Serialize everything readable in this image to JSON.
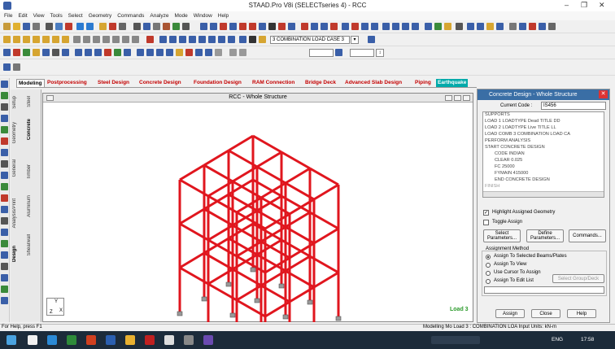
{
  "window": {
    "title": "STAAD.Pro V8i (SELECTseries 4) - RCC",
    "minimize": "–",
    "maximize": "❐",
    "close": "✕"
  },
  "menu": [
    "File",
    "Edit",
    "View",
    "Tools",
    "Select",
    "Geometry",
    "Commands",
    "Analyze",
    "Mode",
    "Window",
    "Help"
  ],
  "toolbar": {
    "load_case": "3 COMBINATION LOAD CASE 3"
  },
  "tabs": [
    "Modeling",
    "Postprocessing",
    "Steel Design",
    "Concrete Design",
    "Foundation Design",
    "RAM Connection",
    "Bridge Deck",
    "Advanced Slab Design",
    "Piping",
    "Earthquake"
  ],
  "vertical_tabs": [
    "Setup",
    "Geometry",
    "General",
    "Analysis/Print",
    "Design",
    "Steel",
    "Concrete",
    "Timber",
    "Aluminum",
    "Shearwall"
  ],
  "viewport": {
    "title": "RCC - Whole Structure",
    "load_label": "Load 3",
    "axis_y": "Y",
    "axis_x": "X",
    "axis_z": "Z"
  },
  "panel": {
    "title": "Concrete Design - Whole Structure",
    "current_code_label": "Current Code :",
    "current_code_value": "IS456",
    "tree": [
      "SUPPORTS",
      "LOAD 1 LOADTYPE Dead  TITLE DD",
      "LOAD 2 LOADTYPE Live  TITLE LL",
      "LOAD COMB 3 COMBINATION LOAD CA",
      "PERFORM ANALYSIS",
      "START CONCRETE DESIGN",
      "CODE INDIAN",
      "CLEAR 0.025",
      "FC 25000",
      "FYMAIN 415000",
      "END CONCRETE DESIGN",
      "FINISH"
    ],
    "highlight_label": "Highlight Assigned Geometry",
    "toggle_label": "Toggle Assign",
    "select_params": "Select Parameters...",
    "define_params": "Define Parameters...",
    "commands": "Commands...",
    "assignment_method": "Assignment Method",
    "radio": [
      "Assign To Selected Beams/Plates",
      "Assign To View",
      "Use Cursor To Assign",
      "Assign To Edit List"
    ],
    "select_group": "Select Group/Deck",
    "assign": "Assign",
    "close": "Close",
    "help": "Help"
  },
  "status": {
    "left": "For Help, press F1",
    "right": "Modelling Mo  Load 3 : COMBINATION LOA  Input Units:  kN-m"
  },
  "taskbar": {
    "lang": "ENG",
    "time": "17:58"
  },
  "colors": {
    "frame": "#e0161e",
    "panel_title": "#3a6ea5",
    "tab_text": "#c40000",
    "earthquake_tab": "#00aaaa"
  }
}
